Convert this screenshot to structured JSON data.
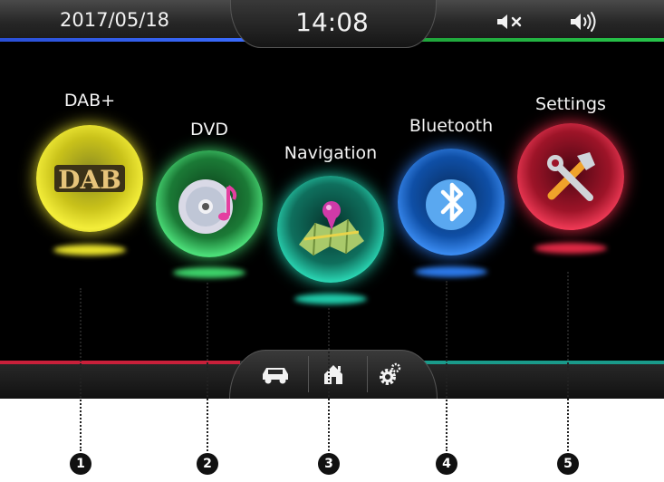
{
  "status_bar": {
    "date": "2017/05/18",
    "time": "14:08",
    "mute_icon": "mute-icon",
    "volume_icon": "volume-icon"
  },
  "apps": [
    {
      "label": "DAB+",
      "icon": "dab-icon",
      "color": "#e8e12a"
    },
    {
      "label": "DVD",
      "icon": "dvd-disc-icon",
      "color": "#3dd36a"
    },
    {
      "label": "Navigation",
      "icon": "map-pin-icon",
      "color": "#1fc9a8"
    },
    {
      "label": "Bluetooth",
      "icon": "bluetooth-icon",
      "color": "#2b78e8"
    },
    {
      "label": "Settings",
      "icon": "tools-icon",
      "color": "#e02844"
    }
  ],
  "dab_logo_text": "DAB",
  "dock": [
    {
      "icon": "car-icon"
    },
    {
      "icon": "home-icon"
    },
    {
      "icon": "gear-icon"
    }
  ],
  "callouts": [
    "1",
    "2",
    "3",
    "4",
    "5"
  ],
  "colors": {
    "top_left_accent": "#2a4fd6",
    "top_right_accent": "#27c44a",
    "bottom_left_accent": "#c8203a",
    "bottom_right_accent": "#1a9a8a"
  }
}
